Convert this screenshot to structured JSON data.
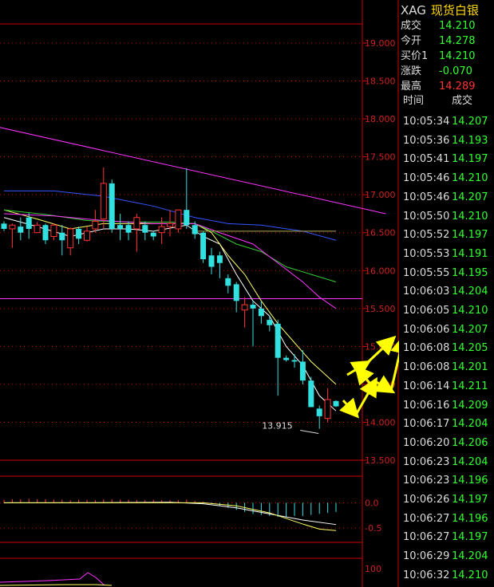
{
  "header": {
    "symbol": "XAG",
    "name": "现货白银"
  },
  "quote": [
    {
      "label": "成交",
      "value": "14.210",
      "color": "#33ff33"
    },
    {
      "label": "今开",
      "value": "14.278",
      "color": "#33ff33"
    },
    {
      "label": "买价1",
      "value": "14.210",
      "color": "#33ff33"
    },
    {
      "label": "涨跌",
      "value": "-0.070",
      "color": "#33ff33"
    },
    {
      "label": "最高",
      "value": "14.289",
      "color": "#ff3333"
    }
  ],
  "ticks_header": {
    "time": "时间",
    "price": "成交"
  },
  "ticks": [
    {
      "time": "10:05:34",
      "price": "14.207"
    },
    {
      "time": "10:05:36",
      "price": "14.193"
    },
    {
      "time": "10:05:41",
      "price": "14.197"
    },
    {
      "time": "10:05:46",
      "price": "14.210"
    },
    {
      "time": "10:05:46",
      "price": "14.207"
    },
    {
      "time": "10:05:50",
      "price": "14.210"
    },
    {
      "time": "10:05:52",
      "price": "14.197"
    },
    {
      "time": "10:05:53",
      "price": "14.191"
    },
    {
      "time": "10:05:55",
      "price": "14.195"
    },
    {
      "time": "10:06:03",
      "price": "14.204"
    },
    {
      "time": "10:06:05",
      "price": "14.210"
    },
    {
      "time": "10:06:06",
      "price": "14.207"
    },
    {
      "time": "10:06:08",
      "price": "14.205"
    },
    {
      "time": "10:06:08",
      "price": "14.201"
    },
    {
      "time": "10:06:14",
      "price": "14.211"
    },
    {
      "time": "10:06:16",
      "price": "14.209"
    },
    {
      "time": "10:06:17",
      "price": "14.204"
    },
    {
      "time": "10:06:20",
      "price": "14.206"
    },
    {
      "time": "10:06:23",
      "price": "14.204"
    },
    {
      "time": "10:06:23",
      "price": "14.196"
    },
    {
      "time": "10:06:26",
      "price": "14.197"
    },
    {
      "time": "10:06:27",
      "price": "14.196"
    },
    {
      "time": "10:06:27",
      "price": "14.197"
    },
    {
      "time": "10:06:29",
      "price": "14.204"
    },
    {
      "time": "10:06:32",
      "price": "14.210"
    }
  ],
  "chart_data": [
    {
      "type": "candlestick",
      "ylim": [
        13.5,
        19.0
      ],
      "yticks": [
        "19.000",
        "18.500",
        "18.000",
        "17.500",
        "17.000",
        "16.500",
        "16.000",
        "15.500",
        "15.000",
        "14.500",
        "14.000",
        "13.500"
      ],
      "min_label": "13.915",
      "colors": {
        "up": "#ff3333",
        "down": "#33e0e0",
        "axis": "#cc0000",
        "ma5": "#ffffff",
        "ma10": "#ffff66",
        "ma20": "#33cc33",
        "ma30": "#ff33ff",
        "ma60": "#3355ff"
      },
      "candles": [
        {
          "o": 16.62,
          "h": 16.65,
          "l": 16.52,
          "c": 16.55
        },
        {
          "o": 16.55,
          "h": 16.62,
          "l": 16.3,
          "c": 16.6
        },
        {
          "o": 16.58,
          "h": 16.7,
          "l": 16.4,
          "c": 16.5
        },
        {
          "o": 16.7,
          "h": 16.76,
          "l": 16.42,
          "c": 16.55
        },
        {
          "o": 16.5,
          "h": 16.64,
          "l": 16.5,
          "c": 16.6
        },
        {
          "o": 16.6,
          "h": 16.62,
          "l": 16.35,
          "c": 16.4
        },
        {
          "o": 16.45,
          "h": 16.62,
          "l": 16.4,
          "c": 16.6
        },
        {
          "o": 16.5,
          "h": 16.6,
          "l": 16.2,
          "c": 16.4
        },
        {
          "o": 16.3,
          "h": 16.57,
          "l": 16.2,
          "c": 16.55
        },
        {
          "o": 16.55,
          "h": 16.58,
          "l": 16.35,
          "c": 16.42
        },
        {
          "o": 16.4,
          "h": 16.58,
          "l": 16.38,
          "c": 16.52
        },
        {
          "o": 16.55,
          "h": 16.8,
          "l": 16.5,
          "c": 16.65
        },
        {
          "o": 16.68,
          "h": 17.36,
          "l": 16.55,
          "c": 17.15
        },
        {
          "o": 17.15,
          "h": 17.2,
          "l": 16.5,
          "c": 16.55
        },
        {
          "o": 16.6,
          "h": 16.75,
          "l": 16.4,
          "c": 16.55
        },
        {
          "o": 16.6,
          "h": 16.65,
          "l": 16.4,
          "c": 16.5
        },
        {
          "o": 16.55,
          "h": 16.75,
          "l": 16.25,
          "c": 16.7
        },
        {
          "o": 16.6,
          "h": 16.65,
          "l": 16.4,
          "c": 16.5
        },
        {
          "o": 16.5,
          "h": 16.52,
          "l": 16.4,
          "c": 16.45
        },
        {
          "o": 16.5,
          "h": 16.7,
          "l": 16.35,
          "c": 16.58
        },
        {
          "o": 16.58,
          "h": 16.8,
          "l": 16.45,
          "c": 16.62
        },
        {
          "o": 16.55,
          "h": 16.8,
          "l": 16.5,
          "c": 16.8
        },
        {
          "o": 16.8,
          "h": 17.35,
          "l": 16.55,
          "c": 16.6
        },
        {
          "o": 16.6,
          "h": 16.65,
          "l": 16.42,
          "c": 16.48
        },
        {
          "o": 16.5,
          "h": 16.52,
          "l": 16.1,
          "c": 16.15
        },
        {
          "o": 16.2,
          "h": 16.3,
          "l": 15.95,
          "c": 16.05
        },
        {
          "o": 16.2,
          "h": 16.25,
          "l": 15.9,
          "c": 16.1
        },
        {
          "o": 15.9,
          "h": 15.95,
          "l": 15.7,
          "c": 15.8
        },
        {
          "o": 15.82,
          "h": 15.85,
          "l": 15.45,
          "c": 15.6
        },
        {
          "o": 15.48,
          "h": 15.65,
          "l": 15.25,
          "c": 15.55
        },
        {
          "o": 15.55,
          "h": 15.6,
          "l": 15.0,
          "c": 15.5
        },
        {
          "o": 15.5,
          "h": 15.6,
          "l": 15.3,
          "c": 15.4
        },
        {
          "o": 15.35,
          "h": 15.4,
          "l": 15.2,
          "c": 15.28
        },
        {
          "o": 15.3,
          "h": 15.35,
          "l": 14.35,
          "c": 14.85
        },
        {
          "o": 14.85,
          "h": 14.88,
          "l": 14.8,
          "c": 14.82
        },
        {
          "o": 14.82,
          "h": 14.9,
          "l": 14.72,
          "c": 14.8
        },
        {
          "o": 14.8,
          "h": 14.95,
          "l": 14.5,
          "c": 14.55
        },
        {
          "o": 14.55,
          "h": 14.6,
          "l": 14.2,
          "c": 14.2
        },
        {
          "o": 14.18,
          "h": 14.22,
          "l": 13.915,
          "c": 14.08
        },
        {
          "o": 14.05,
          "h": 14.45,
          "l": 14.0,
          "c": 14.3
        },
        {
          "o": 14.28,
          "h": 14.29,
          "l": 14.2,
          "c": 14.21
        }
      ],
      "ma_lines": [
        {
          "key": "ma5",
          "points": [
            [
              0,
              16.7
            ],
            [
              4,
              16.58
            ],
            [
              8,
              16.45
            ],
            [
              12,
              16.55
            ],
            [
              15,
              16.55
            ],
            [
              18,
              16.52
            ],
            [
              22,
              16.6
            ],
            [
              24,
              16.45
            ],
            [
              26,
              16.35
            ],
            [
              28,
              15.95
            ],
            [
              30,
              15.6
            ],
            [
              32,
              15.4
            ],
            [
              34,
              15.0
            ],
            [
              36,
              14.75
            ],
            [
              38,
              14.35
            ],
            [
              40,
              14.15
            ]
          ]
        },
        {
          "key": "ma10",
          "points": [
            [
              0,
              16.8
            ],
            [
              4,
              16.68
            ],
            [
              8,
              16.55
            ],
            [
              12,
              16.62
            ],
            [
              16,
              16.62
            ],
            [
              20,
              16.62
            ],
            [
              23,
              16.62
            ],
            [
              25,
              16.5
            ],
            [
              27,
              16.2
            ],
            [
              29,
              15.95
            ],
            [
              31,
              15.6
            ],
            [
              33,
              15.3
            ],
            [
              35,
              15.05
            ],
            [
              37,
              14.8
            ],
            [
              39,
              14.6
            ],
            [
              40,
              14.5
            ]
          ]
        },
        {
          "key": "ma20",
          "points": [
            [
              0,
              16.8
            ],
            [
              5,
              16.74
            ],
            [
              10,
              16.66
            ],
            [
              15,
              16.64
            ],
            [
              20,
              16.64
            ],
            [
              23,
              16.62
            ],
            [
              25,
              16.52
            ],
            [
              28,
              16.35
            ],
            [
              31,
              16.25
            ],
            [
              34,
              16.05
            ],
            [
              37,
              15.95
            ],
            [
              40,
              15.85
            ]
          ]
        },
        {
          "key": "ma30",
          "points": [
            [
              0,
              16.75
            ],
            [
              6,
              16.72
            ],
            [
              12,
              16.66
            ],
            [
              18,
              16.62
            ],
            [
              23,
              16.62
            ],
            [
              26,
              16.5
            ],
            [
              30,
              16.35
            ],
            [
              33,
              16.1
            ],
            [
              36,
              15.85
            ],
            [
              38,
              15.65
            ],
            [
              40,
              15.5
            ]
          ]
        },
        {
          "key": "ma60",
          "points": [
            [
              0,
              17.05
            ],
            [
              6,
              17.05
            ],
            [
              12,
              16.98
            ],
            [
              18,
              16.85
            ],
            [
              23,
              16.7
            ],
            [
              27,
              16.62
            ],
            [
              31,
              16.6
            ],
            [
              36,
              16.52
            ],
            [
              40,
              16.4
            ]
          ]
        },
        {
          "key": "trend",
          "points": [
            [
              -1,
              17.9
            ],
            [
              46,
              16.75
            ]
          ]
        },
        {
          "key": "flat",
          "points": [
            [
              23,
              16.52
            ],
            [
              40,
              16.52
            ]
          ]
        }
      ],
      "hline": 15.63,
      "arrows": [
        [
          [
            430,
            502
          ],
          [
            446,
            520
          ]
        ],
        [
          [
            446,
            520
          ],
          [
            470,
            478
          ]
        ],
        [
          [
            470,
            478
          ],
          [
            490,
            490
          ]
        ],
        [
          [
            490,
            490
          ],
          [
            505,
            425
          ]
        ],
        [
          [
            505,
            425
          ],
          [
            530,
            440
          ]
        ],
        [
          [
            530,
            440
          ],
          [
            595,
            340
          ]
        ],
        [
          [
            435,
            470
          ],
          [
            460,
            455
          ]
        ],
        [
          [
            460,
            455
          ],
          [
            492,
            425
          ]
        ],
        [
          [
            463,
            480
          ],
          [
            448,
            462
          ]
        ]
      ]
    },
    {
      "type": "bar",
      "ylim": [
        -0.75,
        0.4
      ],
      "yticks": [
        "0.0",
        "-0.5"
      ],
      "bars": [
        0.06,
        0.07,
        0.07,
        0.08,
        0.07,
        0.07,
        0.06,
        0.06,
        0.05,
        0.06,
        0.06,
        0.05,
        0.07,
        0.07,
        0.06,
        0.06,
        0.05,
        0.05,
        0.06,
        0.05,
        0.05,
        0.05,
        0.06,
        0.04,
        0.02,
        -0.02,
        -0.06,
        -0.1,
        -0.14,
        -0.18,
        -0.22,
        -0.24,
        -0.26,
        -0.28,
        -0.28,
        -0.26,
        -0.26,
        -0.24,
        -0.22,
        -0.2,
        -0.18
      ],
      "line1": [
        [
          0,
          0.0
        ],
        [
          10,
          0.0
        ],
        [
          20,
          0.01
        ],
        [
          24,
          -0.02
        ],
        [
          28,
          -0.1
        ],
        [
          32,
          -0.22
        ],
        [
          36,
          -0.34
        ],
        [
          40,
          -0.43
        ]
      ],
      "line2": [
        [
          0,
          0.0
        ],
        [
          10,
          0.0
        ],
        [
          20,
          0.0
        ],
        [
          24,
          0.0
        ],
        [
          28,
          -0.06
        ],
        [
          32,
          -0.2
        ],
        [
          36,
          -0.42
        ],
        [
          38,
          -0.52
        ],
        [
          40,
          -0.55
        ]
      ]
    },
    {
      "type": "line",
      "yticks": [
        "100"
      ]
    }
  ]
}
